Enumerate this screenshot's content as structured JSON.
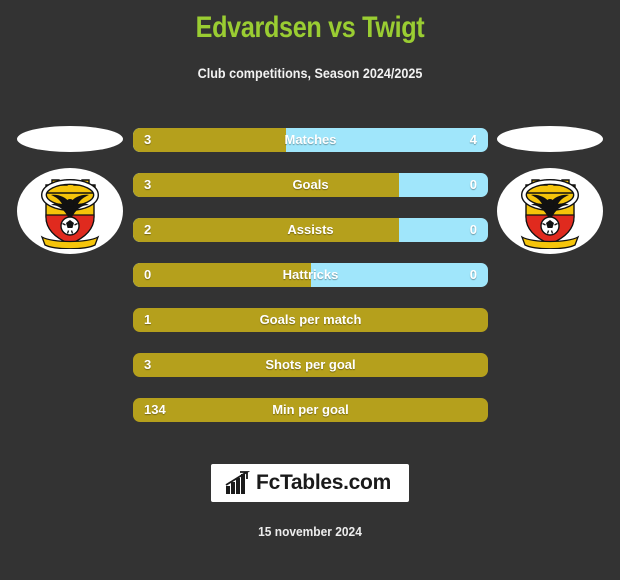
{
  "header": {
    "title": "Edvardsen vs Twigt",
    "subtitle": "Club competitions, Season 2024/2025",
    "title_color": "#9ACD32"
  },
  "theme": {
    "background": "#333333",
    "bar_left_color": "#B5A01C",
    "bar_right_color": "#A0E6FB",
    "text_color": "#FFFFFF"
  },
  "crests": {
    "left": {
      "club_name": "GO AHEAD EAGLES",
      "city": "DEVENTER",
      "icon": "go-ahead-eagles-crest"
    },
    "right": {
      "club_name": "GO AHEAD EAGLES",
      "city": "DEVENTER",
      "icon": "go-ahead-eagles-crest"
    }
  },
  "chart_data": {
    "type": "bar",
    "title": "Edvardsen vs Twigt",
    "subtitle": "Club competitions, Season 2024/2025",
    "orientation": "horizontal-diverging",
    "legend_position": "none",
    "grid": false,
    "series": [
      {
        "name": "Edvardsen",
        "color": "#B5A01C",
        "side": "left"
      },
      {
        "name": "Twigt",
        "color": "#A0E6FB",
        "side": "right"
      }
    ],
    "categories": [
      "Matches",
      "Goals",
      "Assists",
      "Hattricks",
      "Goals per match",
      "Shots per goal",
      "Min per goal"
    ],
    "rows": [
      {
        "label": "Matches",
        "left": "3",
        "right": "4",
        "left_pct": 43,
        "two_sided": true
      },
      {
        "label": "Goals",
        "left": "3",
        "right": "0",
        "left_pct": 75,
        "two_sided": true
      },
      {
        "label": "Assists",
        "left": "2",
        "right": "0",
        "left_pct": 75,
        "two_sided": true
      },
      {
        "label": "Hattricks",
        "left": "0",
        "right": "0",
        "left_pct": 50,
        "two_sided": true
      },
      {
        "label": "Goals per match",
        "left": "1",
        "right": "",
        "left_pct": 100,
        "two_sided": false
      },
      {
        "label": "Shots per goal",
        "left": "3",
        "right": "",
        "left_pct": 100,
        "two_sided": false
      },
      {
        "label": "Min per goal",
        "left": "134",
        "right": "",
        "left_pct": 100,
        "two_sided": false
      }
    ]
  },
  "footer": {
    "logo_text": "FcTables.com",
    "logo_icon": "bar-chart-icon",
    "date": "15 november 2024"
  }
}
